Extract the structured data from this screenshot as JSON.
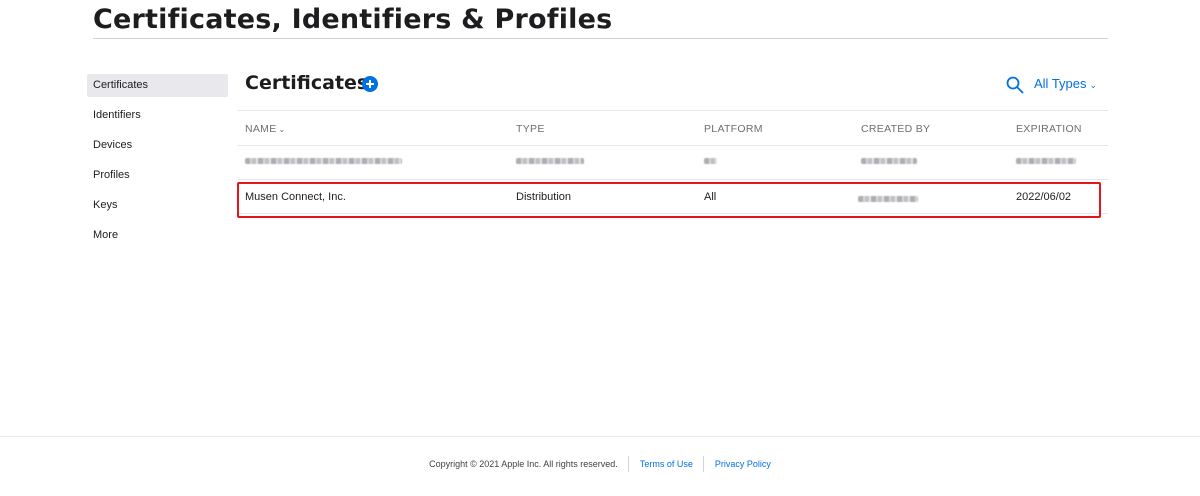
{
  "page": {
    "title": "Certificates, Identifiers & Profiles"
  },
  "sidebar": {
    "items": [
      {
        "label": "Certificates",
        "active": true
      },
      {
        "label": "Identifiers"
      },
      {
        "label": "Devices"
      },
      {
        "label": "Profiles"
      },
      {
        "label": "Keys"
      },
      {
        "label": "More"
      }
    ]
  },
  "main": {
    "section_title": "Certificates",
    "add_icon": "plus-circle-icon",
    "search_icon": "search-icon",
    "filter": {
      "selected": "All Types",
      "icon": "chevron-down-icon"
    }
  },
  "table": {
    "columns": [
      "NAME",
      "TYPE",
      "PLATFORM",
      "CREATED BY",
      "EXPIRATION"
    ],
    "sort_indicator": "chevron-down-icon",
    "rows": [
      {
        "redacted": true,
        "name": "",
        "type": "",
        "platform": "",
        "created_by": "",
        "expiration": ""
      },
      {
        "name": "Musen Connect, Inc.",
        "type": "Distribution",
        "platform": "All",
        "created_by": "",
        "created_by_redacted": true,
        "expiration": "2022/06/02",
        "highlighted": true
      }
    ]
  },
  "footer": {
    "copyright": "Copyright © 2021 Apple Inc. All rights reserved.",
    "terms": "Terms of Use",
    "privacy": "Privacy Policy"
  },
  "colors": {
    "accent": "#0071e3",
    "highlight": "#e8141b",
    "sidebar_active": "#e8e8ed"
  }
}
